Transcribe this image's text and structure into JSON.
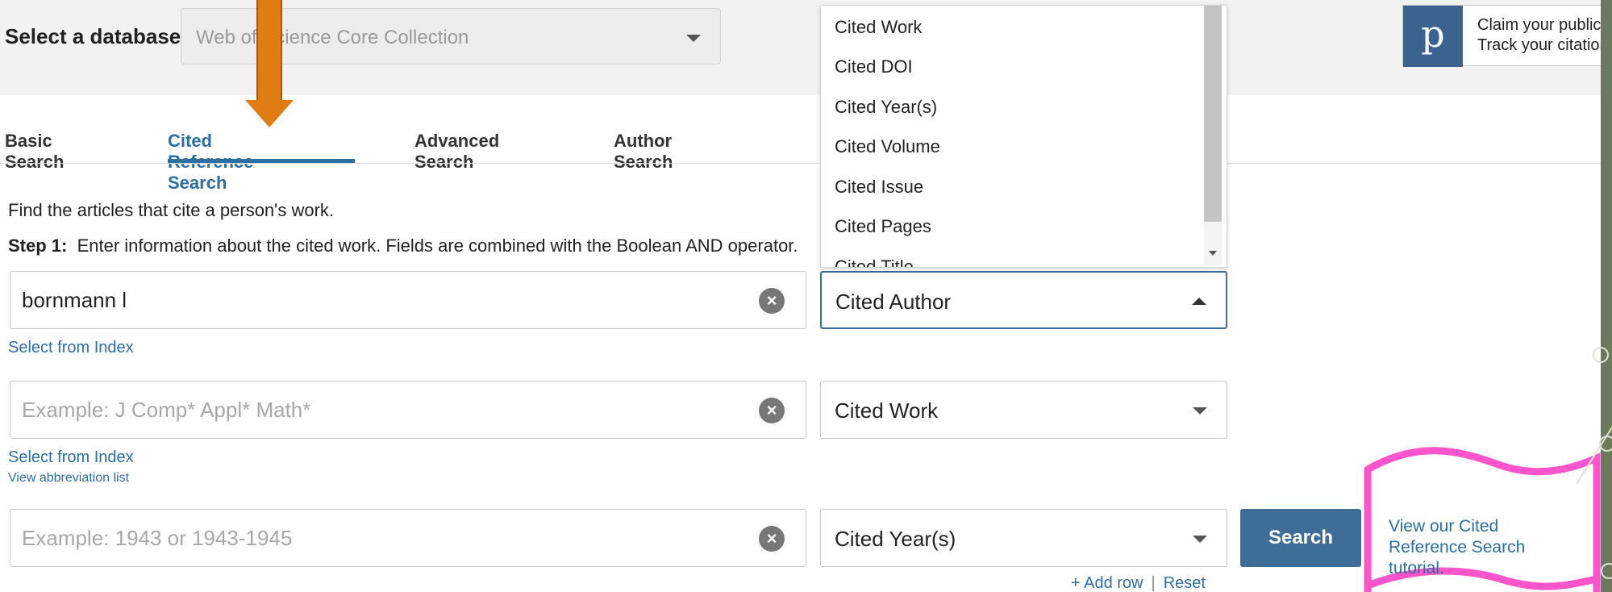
{
  "database": {
    "label": "Select a database",
    "selected": "Web of Science Core Collection"
  },
  "tabs": [
    {
      "label": "Basic Search",
      "active": false
    },
    {
      "label": "Cited Reference Search",
      "active": true
    },
    {
      "label": "Advanced Search",
      "active": false
    },
    {
      "label": "Author Search",
      "active": false
    }
  ],
  "intro_text": "Find the articles that cite a person's work.",
  "step": {
    "label": "Step 1:",
    "text": "Enter information about the cited work. Fields are combined with the Boolean AND operator."
  },
  "rows": [
    {
      "value": "bornmann l",
      "placeholder": "",
      "field": "Cited Author",
      "link": "Select from Index",
      "sublink": ""
    },
    {
      "value": "",
      "placeholder": "Example: J Comp* Appl* Math*",
      "field": "Cited Work",
      "link": "Select from Index",
      "sublink": "View abbreviation list"
    },
    {
      "value": "",
      "placeholder": "Example: 1943 or 1943-1945",
      "field": "Cited Year(s)",
      "link": "",
      "sublink": ""
    }
  ],
  "dropdown_options": [
    "Cited Work",
    "Cited DOI",
    "Cited Year(s)",
    "Cited Volume",
    "Cited Issue",
    "Cited Pages",
    "Cited Title"
  ],
  "buttons": {
    "search": "Search",
    "add_row": "+ Add row",
    "reset": "Reset",
    "separator": "|"
  },
  "tutorial_text": "View our Cited Reference Search tutorial.",
  "publons": {
    "logo": "p",
    "line1": "Claim your publications",
    "line2": "Track your citations"
  },
  "colors": {
    "accent": "#2c6fa3",
    "search_button": "#3e6e98",
    "arrow": "#e07c14",
    "highlight": "#ff55cc"
  }
}
